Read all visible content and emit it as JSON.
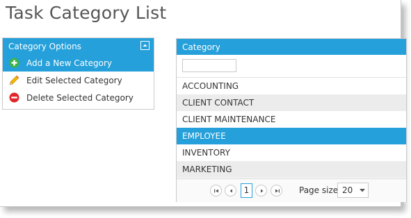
{
  "page": {
    "title": "Task Category List"
  },
  "options_panel": {
    "header": "Category Options",
    "items": [
      {
        "label": "Add a New Category",
        "icon": "add-circle-icon",
        "selected": true
      },
      {
        "label": "Edit Selected Category",
        "icon": "pencil-icon",
        "selected": false
      },
      {
        "label": "Delete Selected Category",
        "icon": "delete-circle-icon",
        "selected": false
      }
    ]
  },
  "grid": {
    "column_header": "Category",
    "filter_value": "",
    "rows": [
      {
        "category": "ACCOUNTING",
        "selected": false
      },
      {
        "category": "CLIENT CONTACT",
        "selected": false
      },
      {
        "category": "CLIENT MAINTENANCE",
        "selected": false
      },
      {
        "category": "EMPLOYEE",
        "selected": true
      },
      {
        "category": "INVENTORY",
        "selected": false
      },
      {
        "category": "MARKETING",
        "selected": false
      }
    ],
    "pager": {
      "current_page": "1",
      "page_size_label": "Page size:",
      "page_size": "20"
    }
  },
  "colors": {
    "accent": "#25a0da",
    "alt_row": "#ececec",
    "add_icon": "#3cb44a",
    "delete_icon": "#e0262b",
    "pencil_icon": "#f2b600"
  }
}
